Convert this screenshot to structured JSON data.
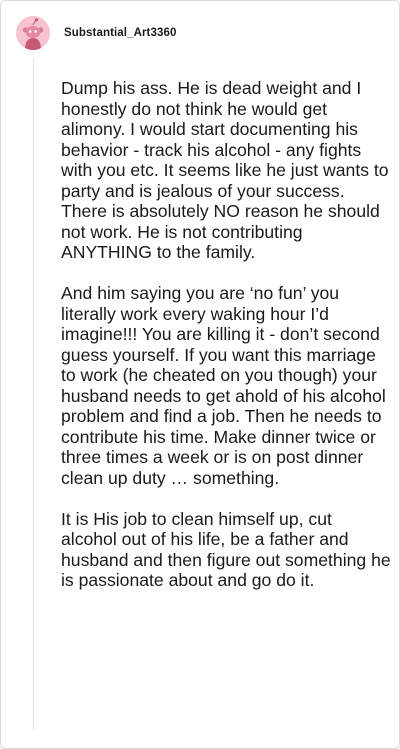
{
  "comment": {
    "author": "Substantial_Art3360",
    "avatar_icon": "snoo-avatar-icon",
    "avatar_color": "#f7c3cf",
    "paragraphs": [
      "Dump his ass. He is dead weight and I honestly do not think he would get alimony. I would start documenting his behavior - track his alcohol - any fights with you etc. It seems like he just wants to party and is jealous of your success. There is absolutely NO reason he should not work. He is not contributing ANYTHING to the family.",
      "And him saying you are ‘no fun’ you literally work every waking hour I’d imagine!!! You are killing it - don’t second guess yourself. If you want this marriage to work (he cheated on you though) your husband needs to get ahold of his alcohol problem and find a job. Then he needs to contribute his time. Make dinner twice or three times a week or is on post dinner clean up duty … something.",
      "It is His job to clean himself up, cut alcohol out of his life, be a father and husband and then figure out something he is passionate about and go do it."
    ]
  }
}
